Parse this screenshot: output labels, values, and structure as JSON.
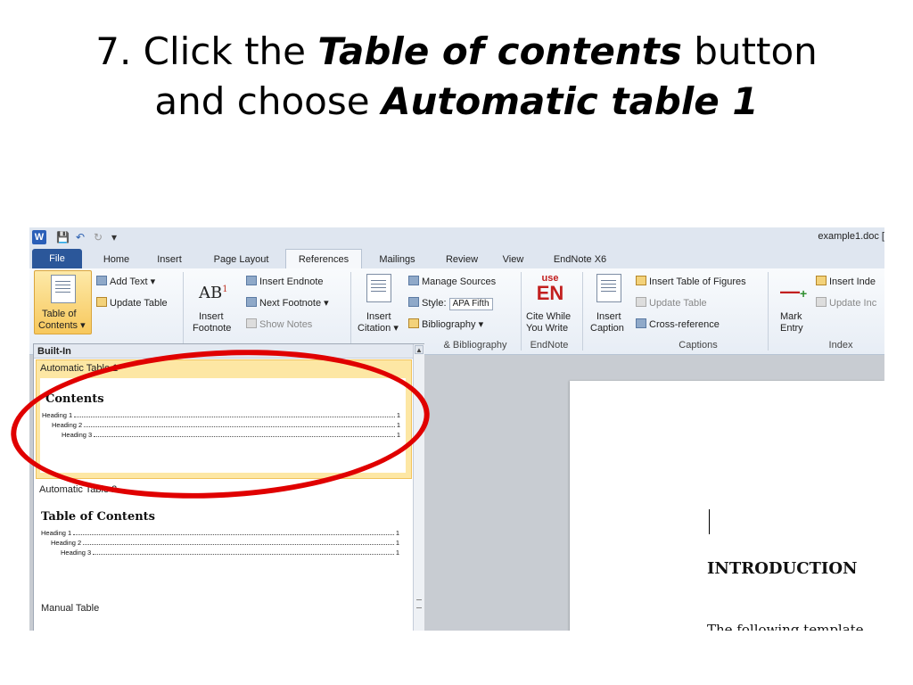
{
  "slide": {
    "title_part1": "7. Click the ",
    "title_bold1": "Table of contents",
    "title_part2": " button",
    "title_part3": "and choose ",
    "title_bold2": "Automatic table 1"
  },
  "app": {
    "logo_letter": "W",
    "window_title": "example1.doc [",
    "qat_icons": [
      "save-icon",
      "undo-icon",
      "redo-icon",
      "customize-icon"
    ]
  },
  "tabs": [
    "File",
    "Home",
    "Insert",
    "Page Layout",
    "References",
    "Mailings",
    "Review",
    "View",
    "EndNote X6"
  ],
  "ribbon": {
    "toc_line1": "Table of",
    "toc_line2": "Contents ▾",
    "add_text": "Add Text ▾",
    "update_table": "Update Table",
    "ab_label": "AB",
    "ab_sup": "1",
    "insert_footnote_1": "Insert",
    "insert_footnote_2": "Footnote",
    "insert_endnote": "Insert Endnote",
    "next_footnote": "Next Footnote ▾",
    "show_notes": "Show Notes",
    "insert_citation_1": "Insert",
    "insert_citation_2": "Citation ▾",
    "manage_sources": "Manage Sources",
    "style_label": "Style:",
    "style_value": "APA Fifth",
    "bibliography": "Bibliography ▾",
    "group_bibliography": "& Bibliography",
    "endnote_use": "use",
    "endnote_en": "EN",
    "cite_while_1": "Cite While",
    "cite_while_2": "You Write",
    "group_endnote": "EndNote",
    "insert_caption_1": "Insert",
    "insert_caption_2": "Caption",
    "insert_table_of_figures": "Insert Table of Figures",
    "update_table_2": "Update Table",
    "cross_reference": "Cross-reference",
    "group_captions": "Captions",
    "mark_entry_1": "Mark",
    "mark_entry_2": "Entry",
    "insert_index": "Insert Inde",
    "update_index": "Update Inc",
    "group_index": "Index"
  },
  "gallery": {
    "section": "Built-In",
    "items": [
      {
        "title": "Automatic Table 1",
        "heading": "Contents",
        "lines": [
          {
            "label": "Heading 1",
            "page": "1"
          },
          {
            "label": "Heading 2",
            "page": "1"
          },
          {
            "label": "Heading 3",
            "page": "1"
          }
        ]
      },
      {
        "title": "Automatic Table 2",
        "heading": "Table of Contents",
        "lines": [
          {
            "label": "Heading 1",
            "page": "1"
          },
          {
            "label": "Heading 2",
            "page": "1"
          },
          {
            "label": "Heading 3",
            "page": "1"
          }
        ]
      }
    ],
    "manual": "Manual Table"
  },
  "document": {
    "heading": "INTRODUCTION",
    "body": "The following template"
  },
  "colors": {
    "highlight": "#fde7a4",
    "annotation": "#e00000",
    "file_tab": "#2b579a"
  }
}
